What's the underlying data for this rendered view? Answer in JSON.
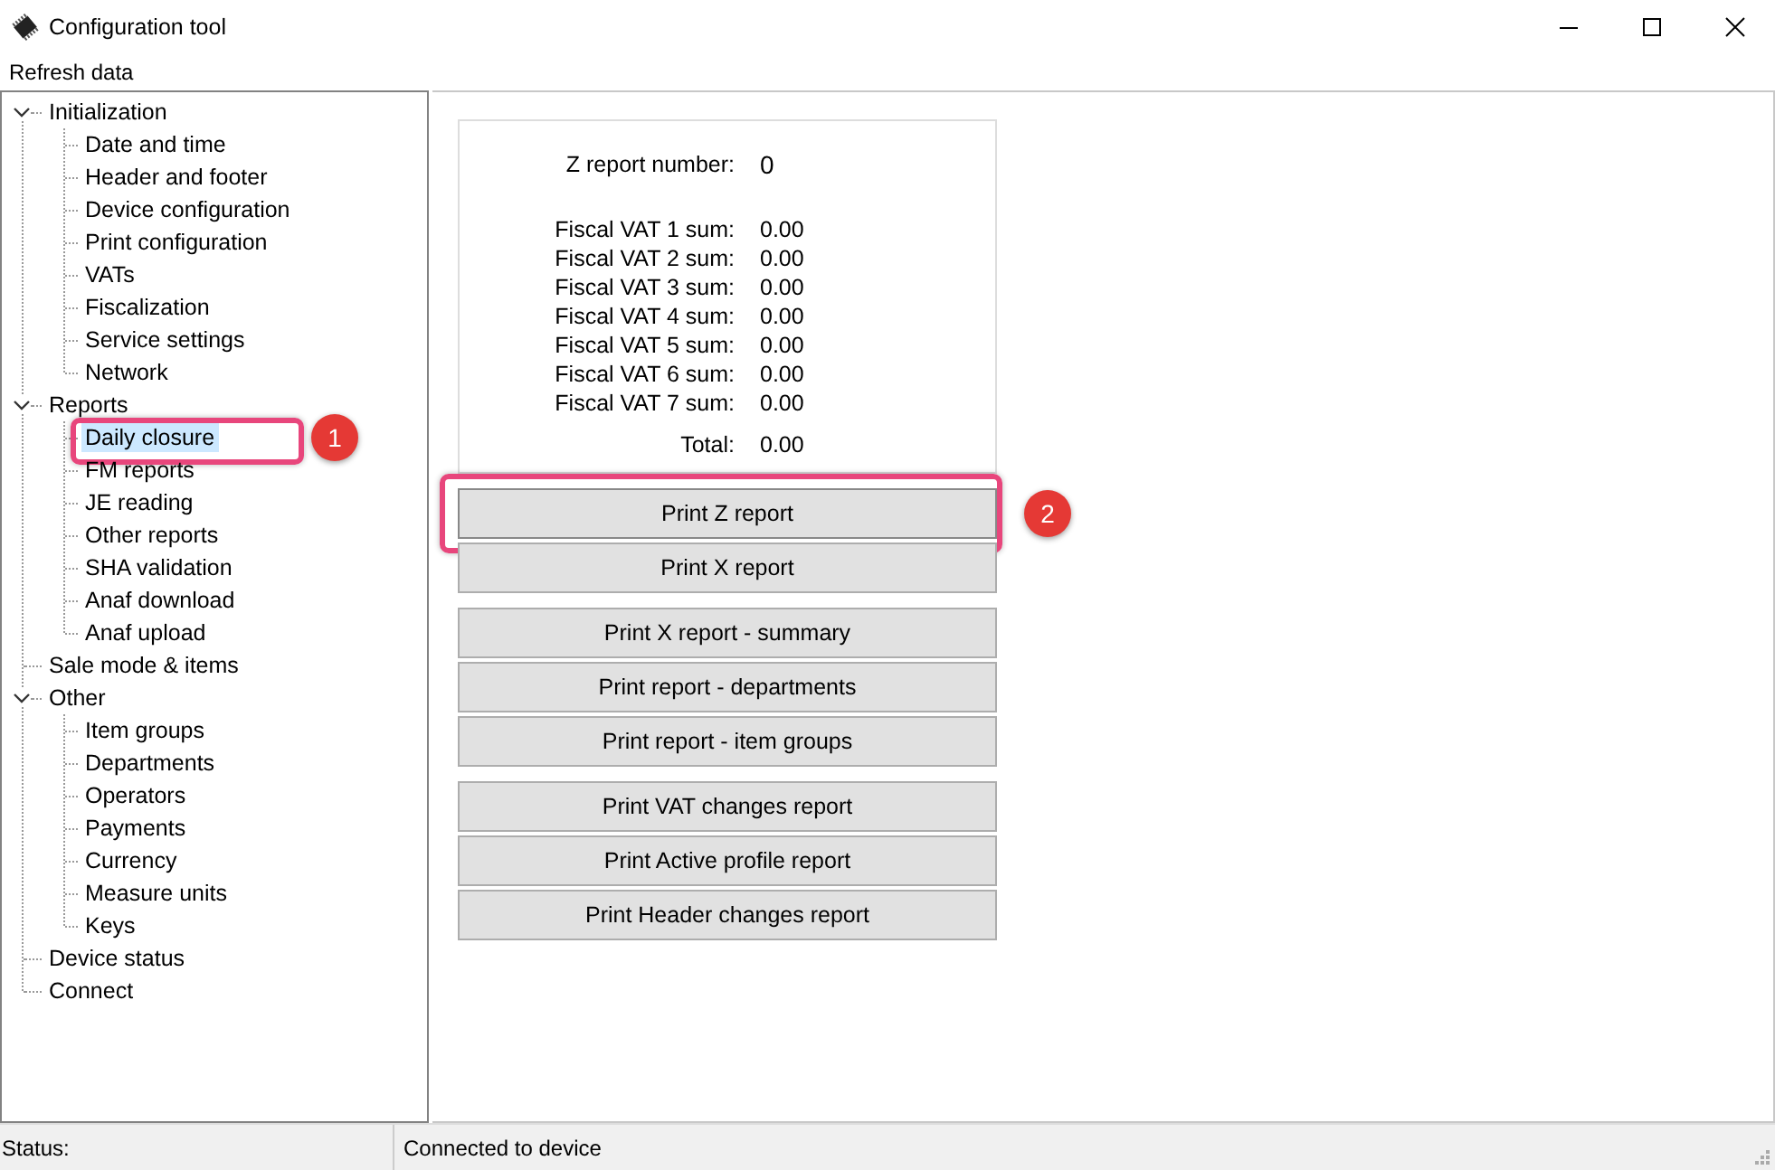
{
  "window": {
    "title": "Configuration tool"
  },
  "menu": [
    "Refresh data"
  ],
  "tree": [
    {
      "label": "Initialization",
      "expanded": true,
      "selected": false,
      "children": [
        {
          "label": "Date and time",
          "selected": false
        },
        {
          "label": "Header and footer",
          "selected": false
        },
        {
          "label": "Device configuration",
          "selected": false
        },
        {
          "label": "Print configuration",
          "selected": false
        },
        {
          "label": "VATs",
          "selected": false
        },
        {
          "label": "Fiscalization",
          "selected": false
        },
        {
          "label": "Service settings",
          "selected": false
        },
        {
          "label": "Network",
          "selected": false
        }
      ]
    },
    {
      "label": "Reports",
      "expanded": true,
      "selected": false,
      "children": [
        {
          "label": "Daily closure",
          "selected": true,
          "callout": "1"
        },
        {
          "label": "FM reports",
          "selected": false
        },
        {
          "label": "JE reading",
          "selected": false
        },
        {
          "label": "Other reports",
          "selected": false
        },
        {
          "label": "SHA validation",
          "selected": false
        },
        {
          "label": "Anaf download",
          "selected": false
        },
        {
          "label": "Anaf upload",
          "selected": false
        }
      ]
    },
    {
      "label": "Sale mode & items",
      "selected": false
    },
    {
      "label": "Other",
      "expanded": true,
      "selected": false,
      "children": [
        {
          "label": "Item groups",
          "selected": false
        },
        {
          "label": "Departments",
          "selected": false
        },
        {
          "label": "Operators",
          "selected": false
        },
        {
          "label": "Payments",
          "selected": false
        },
        {
          "label": "Currency",
          "selected": false
        },
        {
          "label": "Measure units",
          "selected": false
        },
        {
          "label": "Keys",
          "selected": false
        }
      ]
    },
    {
      "label": "Device status",
      "selected": false
    },
    {
      "label": "Connect",
      "selected": false
    }
  ],
  "summary": {
    "report_number": {
      "label": "Z report number:",
      "value": "0"
    },
    "sums": [
      {
        "label": "Fiscal VAT 1 sum:",
        "value": "0.00"
      },
      {
        "label": "Fiscal VAT 2 sum:",
        "value": "0.00"
      },
      {
        "label": "Fiscal VAT 3 sum:",
        "value": "0.00"
      },
      {
        "label": "Fiscal VAT 4 sum:",
        "value": "0.00"
      },
      {
        "label": "Fiscal VAT 5 sum:",
        "value": "0.00"
      },
      {
        "label": "Fiscal VAT 6 sum:",
        "value": "0.00"
      },
      {
        "label": "Fiscal VAT 7 sum:",
        "value": "0.00"
      }
    ],
    "total": {
      "label": "Total:",
      "value": "0.00"
    }
  },
  "button_groups": [
    [
      {
        "label": "Print Z report",
        "callout": "2"
      },
      {
        "label": "Print X report"
      }
    ],
    [
      {
        "label": "Print X report - summary"
      },
      {
        "label": "Print report - departments"
      },
      {
        "label": "Print report - item groups"
      }
    ],
    [
      {
        "label": "Print VAT changes report"
      },
      {
        "label": "Print Active profile report"
      },
      {
        "label": "Print Header changes report"
      }
    ]
  ],
  "status_bar": {
    "label": "Status:",
    "message": "Connected to device"
  }
}
